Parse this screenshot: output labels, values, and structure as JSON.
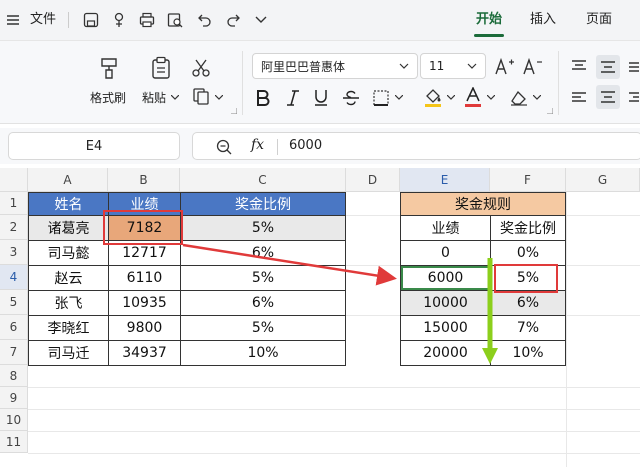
{
  "menubar": {
    "file_label": "文件",
    "tabs": [
      "开始",
      "插入",
      "页面"
    ]
  },
  "ribbon": {
    "format_painter": "格式刷",
    "paste": "粘贴",
    "font_name": "阿里巴巴普惠体",
    "font_size": "11"
  },
  "formula_bar": {
    "cell_ref": "E4",
    "fx_label": "fx",
    "value": "6000"
  },
  "sheet": {
    "columns": [
      "A",
      "B",
      "C",
      "D",
      "E",
      "F",
      "G"
    ],
    "rows": [
      "1",
      "2",
      "3",
      "4",
      "5",
      "6",
      "7",
      "8",
      "9",
      "10",
      "11"
    ],
    "main_table": {
      "headers": [
        "姓名",
        "业绩",
        "奖金比例"
      ],
      "rows": [
        [
          "诸葛亮",
          "7182",
          "5%"
        ],
        [
          "司马懿",
          "12717",
          "6%"
        ],
        [
          "赵云",
          "6110",
          "5%"
        ],
        [
          "张飞",
          "10935",
          "6%"
        ],
        [
          "李晓红",
          "9800",
          "5%"
        ],
        [
          "司马迁",
          "34937",
          "10%"
        ]
      ]
    },
    "rule_table": {
      "title": "奖金规则",
      "headers": [
        "业绩",
        "奖金比例"
      ],
      "rows": [
        [
          "0",
          "0%"
        ],
        [
          "6000",
          "5%"
        ],
        [
          "10000",
          "6%"
        ],
        [
          "15000",
          "7%"
        ],
        [
          "20000",
          "10%"
        ]
      ]
    }
  },
  "colors": {
    "header_blue": "#4a77c4",
    "header_orange": "#f5c9a2",
    "highlight": "#e8a77a",
    "annotation_red": "#e03a3a",
    "annotation_green": "#8ccf1c"
  }
}
